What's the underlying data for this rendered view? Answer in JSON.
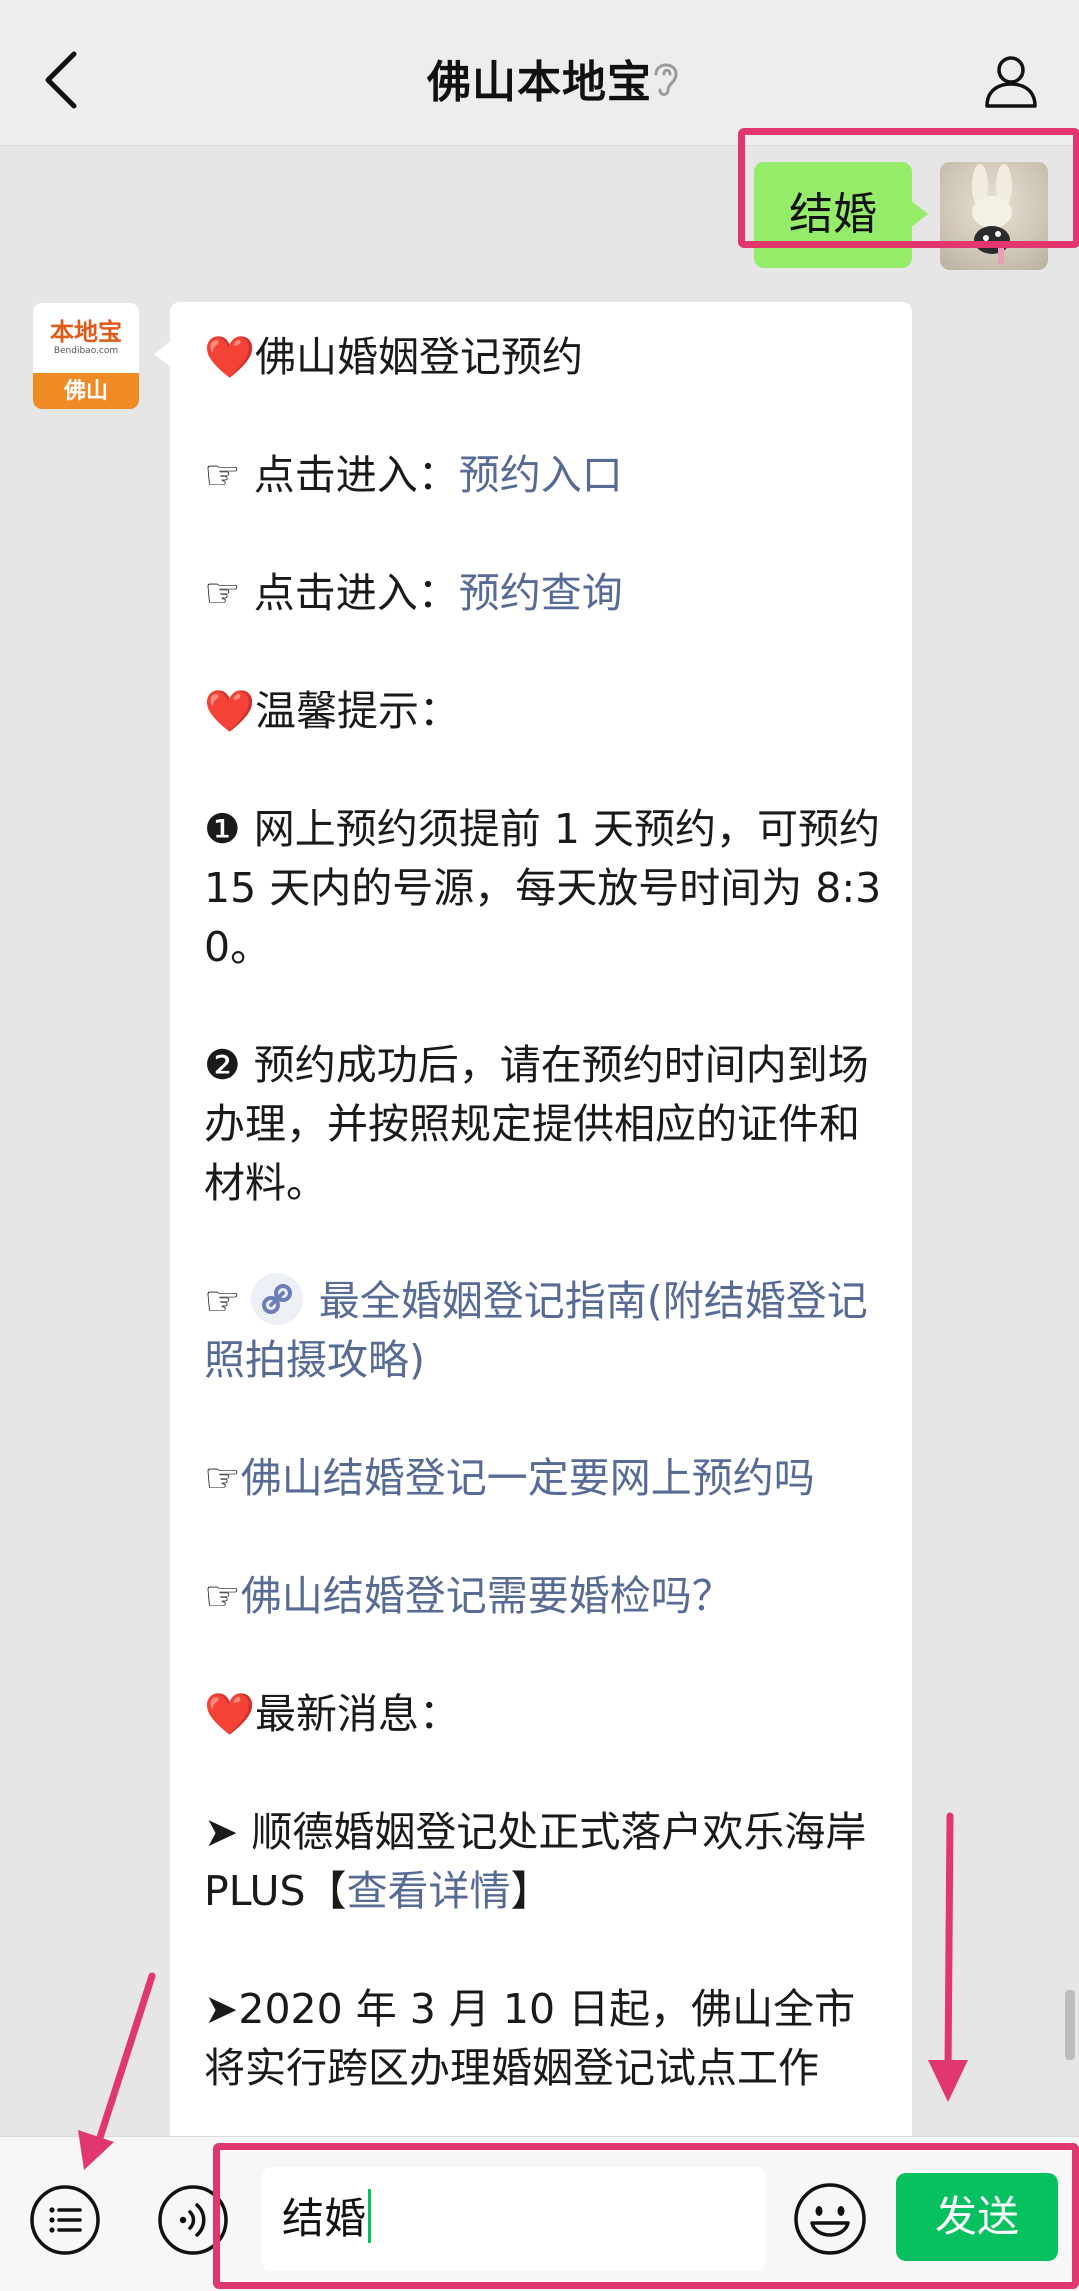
{
  "header": {
    "title": "佛山本地宝",
    "back_icon": "chevron-left-icon",
    "ear_icon": "ear-icon",
    "profile_icon": "person-icon"
  },
  "outgoing_message": {
    "text": "结婚"
  },
  "bot": {
    "avatar_brand": "本地宝",
    "avatar_domain": "Bendibao.com",
    "avatar_city": "佛山"
  },
  "reply": {
    "heading": "❤️佛山婚姻登记预约",
    "entry_prefix": "☞ 点击进入：",
    "entry_link": "预约入口",
    "query_prefix": "☞ 点击进入：",
    "query_link": "预约查询",
    "tips_heading": "❤️温馨提示：",
    "tip1": "❶ 网上预约须提前 1 天预约，可预约 15 天内的号源，每天放号时间为 8:30。",
    "tip2": "❷ 预约成功后，请在预约时间内到场办理，并按照规定提供相应的证件和材料。",
    "pointer": "☞",
    "guide_link": "最全婚姻登记指南(附结婚登记照拍摄攻略)",
    "online_link": "佛山结婚登记一定要网上预约吗",
    "exam_link": "佛山结婚登记需要婚检吗？",
    "news_heading": "❤️最新消息：",
    "news1_text": "➤ 顺德婚姻登记处正式落户欢乐海岸 PLUS【",
    "news1_link": "查看详情",
    "news1_end": "】",
    "news2_text": "➤2020 年 3 月 10 日起，佛山全市将实行跨区办理婚姻登记试点工作"
  },
  "input_bar": {
    "menu_icon": "list-icon",
    "voice_icon": "voice-icon",
    "input_value": "结婚",
    "emoji_icon": "smiley-icon",
    "send_label": "发送"
  },
  "colors": {
    "bubble_green": "#95ec69",
    "link": "#576b95",
    "send_green": "#07c160",
    "highlight": "#e0376f"
  }
}
